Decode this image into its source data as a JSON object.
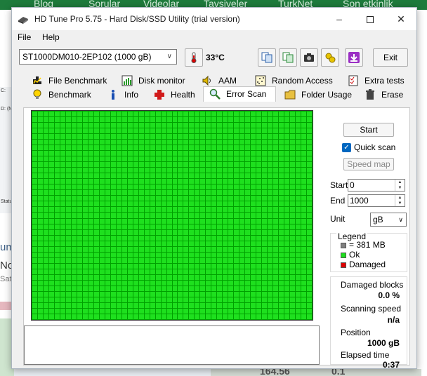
{
  "window": {
    "title": "HD Tune Pro 5.75 - Hard Disk/SSD Utility (trial version)",
    "minimize": "–",
    "close": "✕"
  },
  "menu": {
    "file": "File",
    "help": "Help"
  },
  "toolbar": {
    "drive": "ST1000DM010-2EP102 (1000 gB)",
    "temperature": "33°C",
    "exit_label": "Exit"
  },
  "tabs": {
    "row1": [
      {
        "label": "File Benchmark",
        "icon": "file-benchmark-icon"
      },
      {
        "label": "Disk monitor",
        "icon": "disk-monitor-icon"
      },
      {
        "label": "AAM",
        "icon": "speaker-icon"
      },
      {
        "label": "Random Access",
        "icon": "random-access-icon"
      },
      {
        "label": "Extra tests",
        "icon": "extra-tests-icon"
      }
    ],
    "row2": [
      {
        "label": "Benchmark",
        "icon": "benchmark-icon"
      },
      {
        "label": "Info",
        "icon": "info-icon"
      },
      {
        "label": "Health",
        "icon": "health-icon"
      },
      {
        "label": "Error Scan",
        "icon": "magnifier-icon",
        "active": true
      },
      {
        "label": "Folder Usage",
        "icon": "folder-icon"
      },
      {
        "label": "Erase",
        "icon": "trash-icon"
      }
    ]
  },
  "error_scan": {
    "start_button": "Start",
    "quick_scan_label": "Quick scan",
    "quick_scan_checked": true,
    "speed_map_button": "Speed map",
    "start_label": "Start",
    "start_value": "0",
    "end_label": "End",
    "end_value": "1000",
    "unit_label": "Unit",
    "unit_value": "gB",
    "legend": {
      "title": "Legend",
      "block_size": "= 381 MB",
      "ok": "Ok",
      "damaged": "Damaged",
      "colors": {
        "block": "#808080",
        "ok": "#1ee01e",
        "damaged": "#e00000"
      }
    },
    "stats": {
      "damaged_blocks_label": "Damaged blocks",
      "damaged_blocks_value": "0.0 %",
      "scanning_speed_label": "Scanning speed",
      "scanning_speed_value": "n/a",
      "position_label": "Position",
      "position_value": "1000 gB",
      "elapsed_label": "Elapsed time",
      "elapsed_value": "0:37"
    }
  },
  "background": {
    "top_links": [
      "Blog",
      "Sorular",
      "Videolar",
      "Tavsiyeler",
      "TurkNet",
      "Son etkinlik"
    ],
    "left_texts": [
      "C:",
      "D: (N",
      "Status",
      "um",
      "No",
      "Sati"
    ],
    "bottom_value": "164.56",
    "bottom_value2": "0.1"
  }
}
